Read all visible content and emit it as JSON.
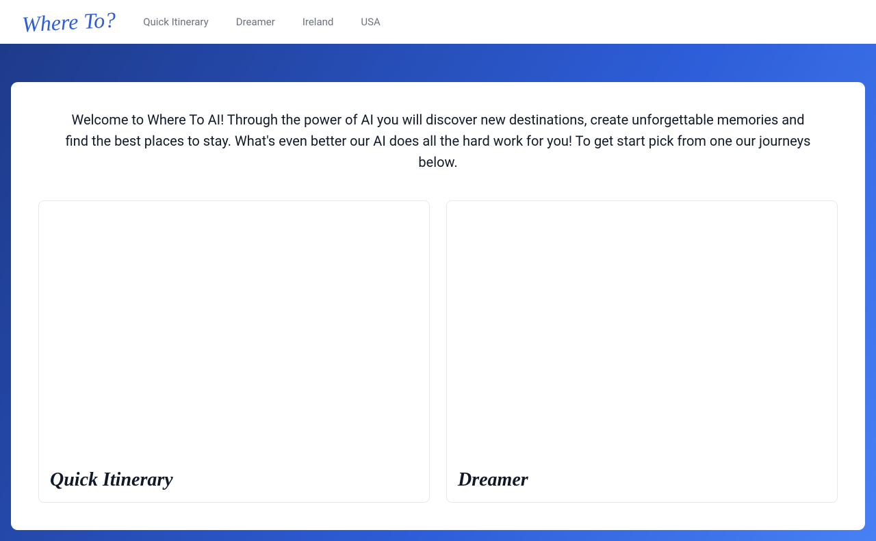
{
  "navbar": {
    "logo": "Where To?",
    "links": [
      {
        "label": "Quick Itinerary"
      },
      {
        "label": "Dreamer"
      },
      {
        "label": "Ireland"
      },
      {
        "label": "USA"
      }
    ]
  },
  "main": {
    "welcome_text": "Welcome to Where To AI! Through the power of AI you will discover new destinations, create unforgettable memories and find the best places to stay. What's even better our AI does all the hard work for you! To get start pick from one our journeys below.",
    "cards": [
      {
        "title": "Quick Itinerary"
      },
      {
        "title": "Dreamer"
      }
    ]
  }
}
